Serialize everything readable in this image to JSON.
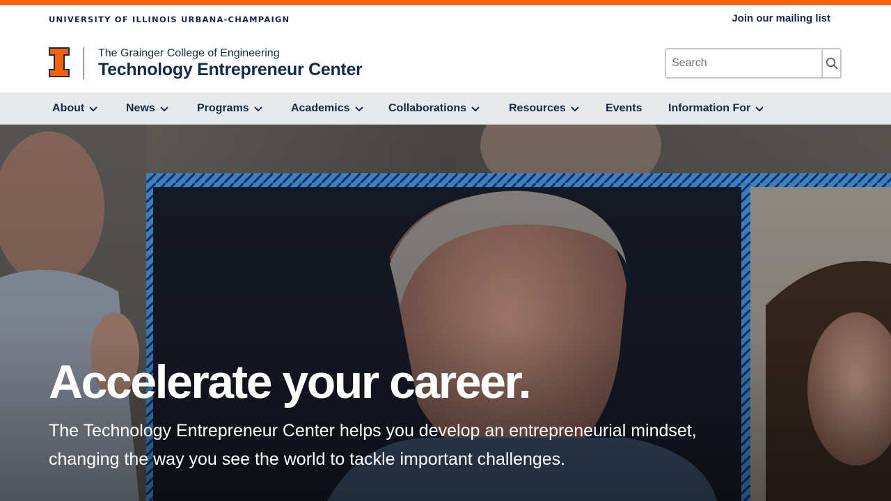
{
  "header": {
    "university_name": "UNIVERSITY OF ILLINOIS URBANA-CHAMPAIGN",
    "mailing_link": "Join our mailing list",
    "college": "The Grainger College of Engineering",
    "center": "Technology Entrepreneur Center",
    "logo_icon": "block-i-logo"
  },
  "search": {
    "placeholder": "Search",
    "value": "",
    "button_icon": "search-icon"
  },
  "nav": {
    "items": [
      {
        "label": "About",
        "has_dropdown": true
      },
      {
        "label": "News",
        "has_dropdown": true
      },
      {
        "label": "Programs",
        "has_dropdown": true
      },
      {
        "label": "Academics",
        "has_dropdown": true
      },
      {
        "label": "Collaborations",
        "has_dropdown": true
      },
      {
        "label": "Resources",
        "has_dropdown": true
      },
      {
        "label": "Events",
        "has_dropdown": false
      },
      {
        "label": "Information For",
        "has_dropdown": true
      }
    ]
  },
  "hero": {
    "title": "Accelerate your career.",
    "subtitle": "The Technology Entrepreneur Center helps you develop an entrepreneurial mindset, changing the way you see the world to tackle important challenges."
  },
  "colors": {
    "orange": "#ff5f05",
    "navy": "#13294b",
    "nav_bg": "#e8e9eb"
  }
}
